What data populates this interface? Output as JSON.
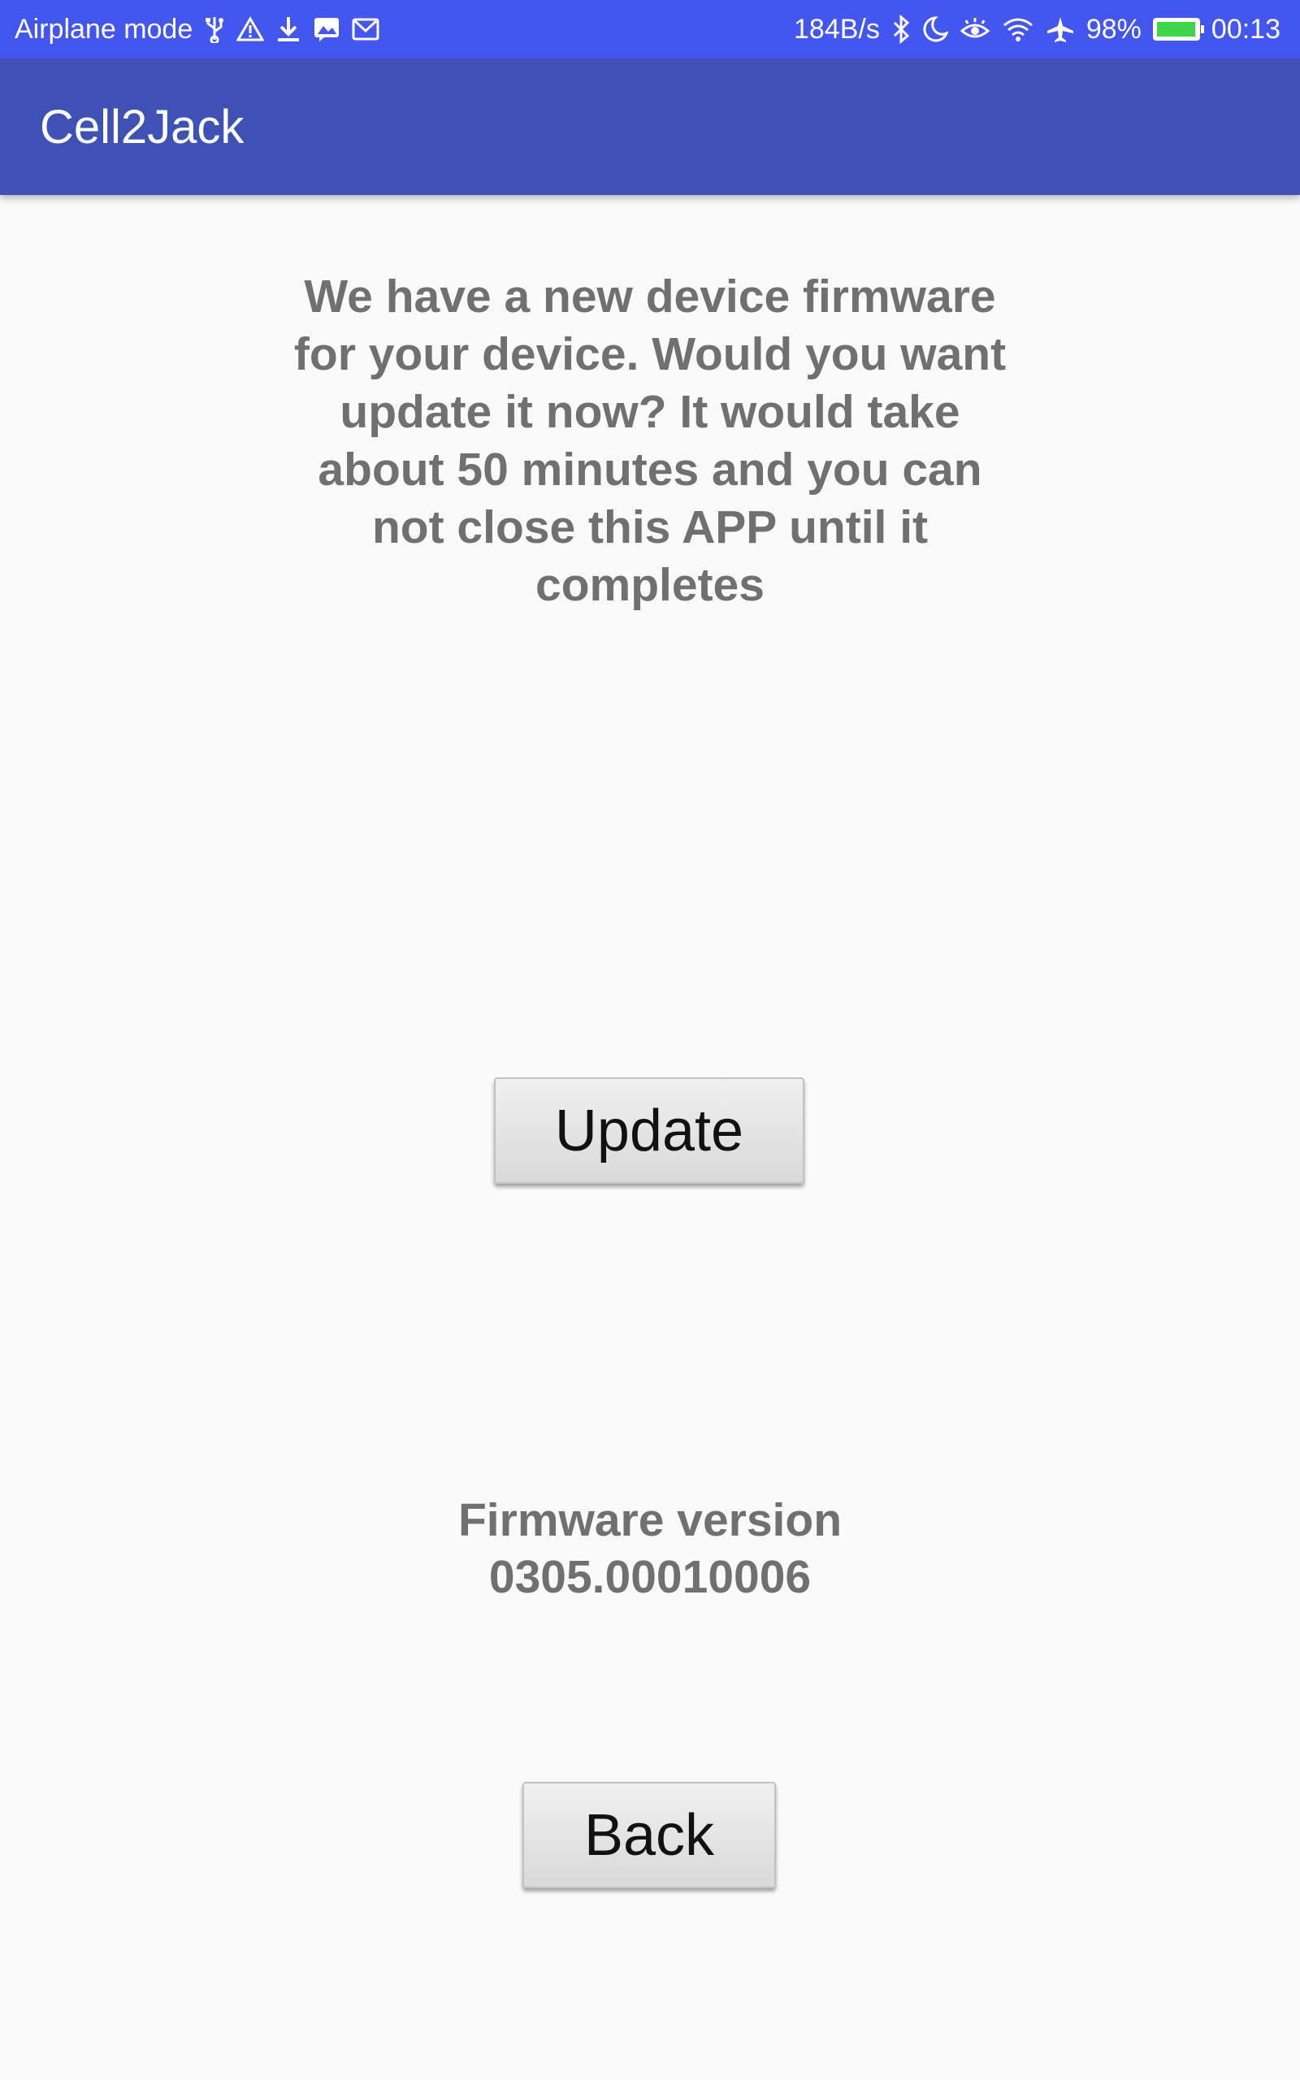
{
  "status_bar": {
    "mode_text": "Airplane mode",
    "network_speed": "184B/s",
    "battery_percent": "98%",
    "battery_level": 0.98,
    "time": "00:13",
    "icons_left": [
      "usb-icon",
      "warning-icon",
      "download-icon",
      "image-notification-icon",
      "gmail-icon"
    ],
    "icons_right": [
      "bluetooth-icon",
      "moon-icon",
      "eye-icon",
      "wifi-icon",
      "airplane-icon",
      "battery-icon"
    ]
  },
  "app_bar": {
    "title": "Cell2Jack",
    "color": "#3f51b5"
  },
  "main": {
    "message": "We have a new device firmware for your device. Would you want update it now? It would take about 50 minutes and you can not close this APP until it completes",
    "update_label": "Update",
    "firmware_label": "Firmware version",
    "firmware_value": "0305.00010006",
    "back_label": "Back"
  }
}
